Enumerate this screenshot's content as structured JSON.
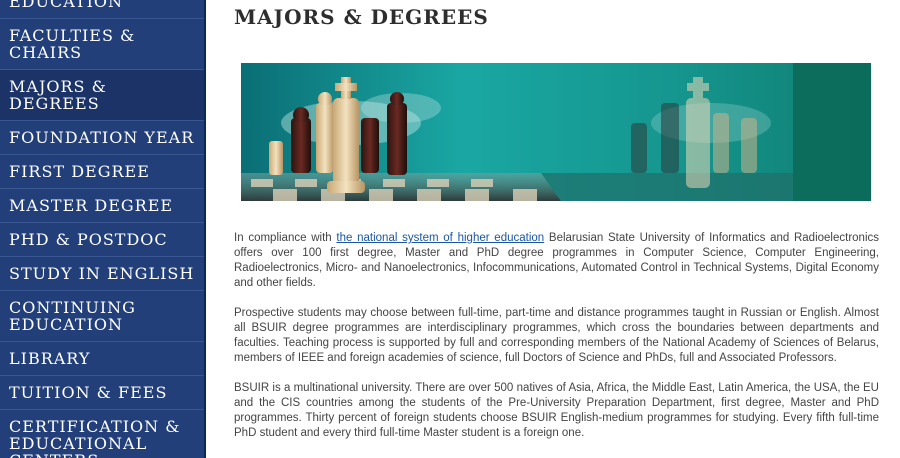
{
  "sidebar": {
    "items": [
      {
        "label": "Education"
      },
      {
        "label": "Faculties & Chairs"
      },
      {
        "label": "Majors & Degrees"
      },
      {
        "label": "Foundation Year"
      },
      {
        "label": "First Degree"
      },
      {
        "label": "Master Degree"
      },
      {
        "label": "PhD & Postdoc"
      },
      {
        "label": "Study in English"
      },
      {
        "label": "Continuing Education"
      },
      {
        "label": "Library"
      },
      {
        "label": "Tuition & Fees"
      },
      {
        "label": "Certification & Educational Centers"
      }
    ]
  },
  "main": {
    "title": "Majors & Degrees",
    "paragraphs": [
      {
        "pre": "In compliance with ",
        "link": "the national system of higher education",
        "post": " Belarusian State University of Informatics and Radioelectronics offers over 100 first degree, Master and PhD degree programmes in Computer Science, Computer Engineering, Radioelectronics, Micro- and Nanoelectronics, Infocommunications, Automated Control in Technical Systems, Digital Economy and other fields."
      },
      {
        "text": "Prospective students may choose between full-time, part-time and distance programmes taught in Russian or English. Almost all BSUIR degree programmes are interdisciplinary programmes, which cross the boundaries between departments and faculties. Teaching process is supported by full and corresponding members of the National Academy of Sciences of Belarus, members of IEEE and foreign academies of science, full Doctors of Science and PhDs, full and Associated Professors."
      },
      {
        "text": "BSUIR is a multinational university. There are over 500 natives of Asia, Africa, the Middle East, Latin America, the USA, the EU and the CIS countries among the students of the Pre-University Preparation Department, first degree, Master and PhD programmes. Thirty percent of foreign students choose BSUIR English-medium programmes for studying. Every fifth full-time PhD student and every third full-time Master student is a foreign one."
      }
    ]
  },
  "colors": {
    "sidebar_bg": "#223f7a",
    "link": "#1a56a6",
    "banner_teal": "#0f8d85"
  }
}
